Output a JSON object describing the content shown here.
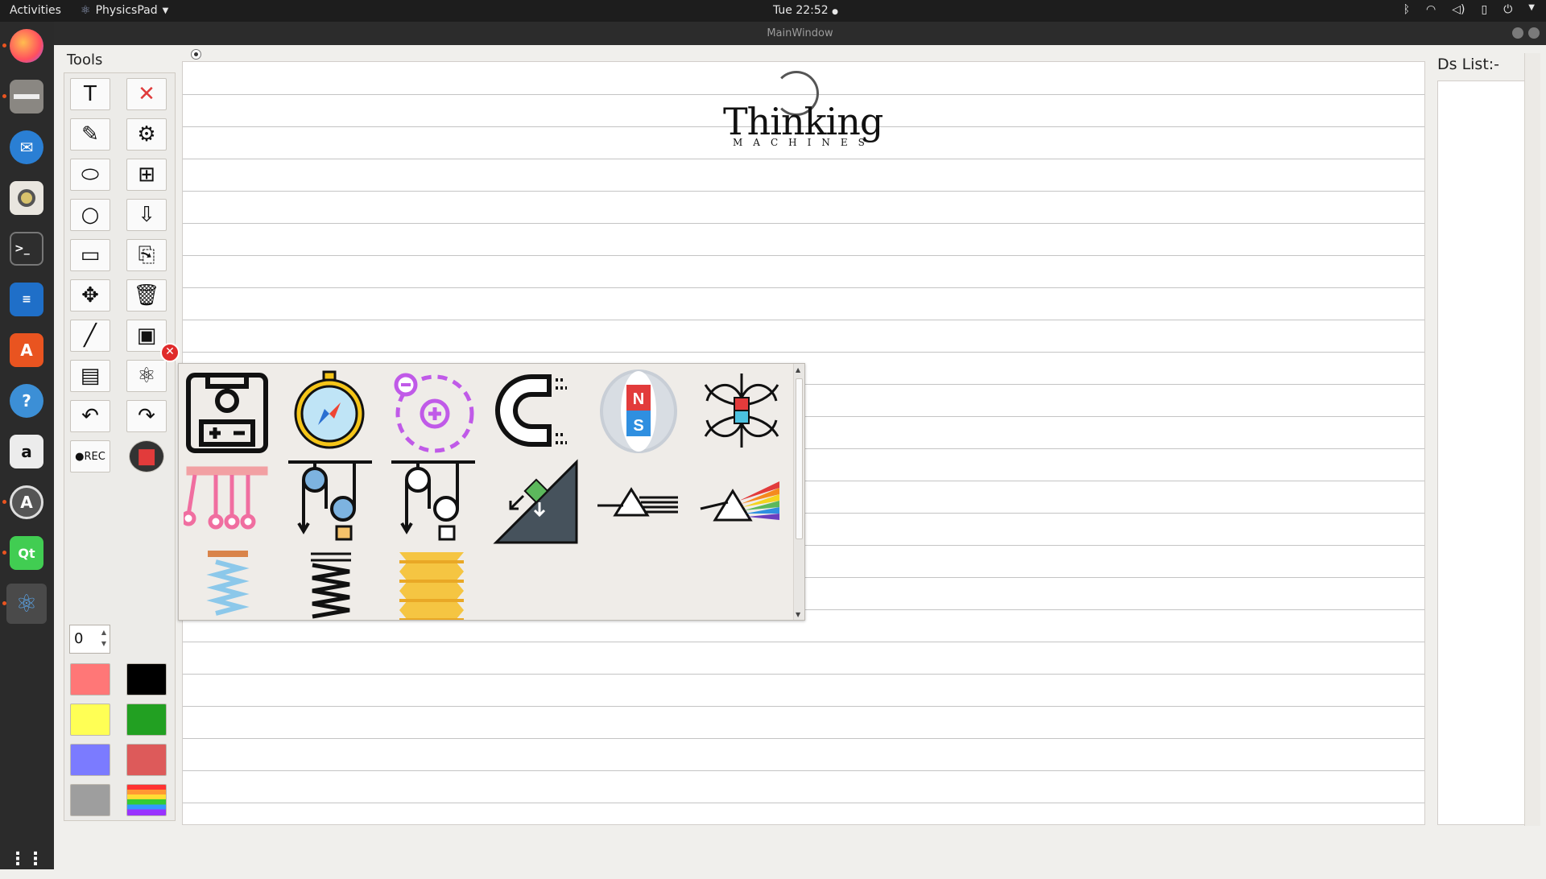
{
  "topbar": {
    "activities": "Activities",
    "app_name": "PhysicsPad",
    "clock": "Tue 22:52"
  },
  "window": {
    "title": "MainWindow"
  },
  "dock": {
    "items": [
      {
        "name": "firefox-icon",
        "color": "#ff7139"
      },
      {
        "name": "files-icon",
        "color": "#8a8782"
      },
      {
        "name": "thunderbird-icon",
        "color": "#2a7fd4"
      },
      {
        "name": "rhythmbox-icon",
        "color": "#d7c26c"
      },
      {
        "name": "terminal-icon",
        "color": "#2e2e2e"
      },
      {
        "name": "writer-icon",
        "color": "#1f6fc8"
      },
      {
        "name": "software-center-icon",
        "color": "#e95420"
      },
      {
        "name": "help-icon",
        "color": "#3c8fd6"
      },
      {
        "name": "amazon-icon",
        "color": "#ececec"
      },
      {
        "name": "updater-icon",
        "color": "#555"
      },
      {
        "name": "qt-creator-icon",
        "color": "#41cd52"
      },
      {
        "name": "physicspad-icon",
        "color": "#3b4a6a"
      },
      {
        "name": "show-apps-icon",
        "color": "#2b2b2b"
      }
    ]
  },
  "tools": {
    "title": "Tools",
    "buttons": [
      {
        "name": "text-tool",
        "glyph": "T"
      },
      {
        "name": "delete-tool",
        "glyph": "✕"
      },
      {
        "name": "pencil-tool",
        "glyph": "✎"
      },
      {
        "name": "network-tool",
        "glyph": "⚙"
      },
      {
        "name": "ellipse-tool",
        "glyph": "⬭"
      },
      {
        "name": "hierarchy-tool",
        "glyph": "⊞"
      },
      {
        "name": "circle-tool",
        "glyph": "○"
      },
      {
        "name": "import-tool",
        "glyph": "⇩"
      },
      {
        "name": "rectangle-tool",
        "glyph": "▭"
      },
      {
        "name": "book-tool",
        "glyph": "⎘"
      },
      {
        "name": "move-tool",
        "glyph": "✥"
      },
      {
        "name": "trash-tool",
        "glyph": "🗑"
      },
      {
        "name": "line-tool",
        "glyph": "╱"
      },
      {
        "name": "image-tool",
        "glyph": "▣"
      },
      {
        "name": "pages-tool",
        "glyph": "▤"
      },
      {
        "name": "physics-tool",
        "glyph": "⚛"
      },
      {
        "name": "undo-tool",
        "glyph": "↶"
      },
      {
        "name": "redo-tool",
        "glyph": "↷"
      },
      {
        "name": "record-tool",
        "glyph": "●REC"
      },
      {
        "name": "stop-tool",
        "glyph": "■"
      }
    ],
    "size_value": "0",
    "colors": [
      "#ff7777",
      "#000000",
      "#ffff55",
      "#22a022",
      "#7b7bff",
      "#dd5a5a",
      "#9e9e9e",
      "rainbow"
    ]
  },
  "canvas": {
    "logo_word": "Thinking",
    "logo_sub": "MACHINES"
  },
  "ds_list": {
    "title": "Ds List:-"
  },
  "popup": {
    "items": [
      "battery-circuit-icon",
      "compass-icon",
      "charges-icon",
      "horseshoe-magnet-icon",
      "bar-magnet-icon",
      "magnetic-field-icon",
      "newtons-cradle-icon",
      "pulley-icon",
      "pulley-block-icon",
      "inclined-plane-icon",
      "prism-icon",
      "dispersion-prism-icon",
      "spring-blue-icon",
      "spring-black-icon",
      "spring-yellow-icon"
    ]
  }
}
